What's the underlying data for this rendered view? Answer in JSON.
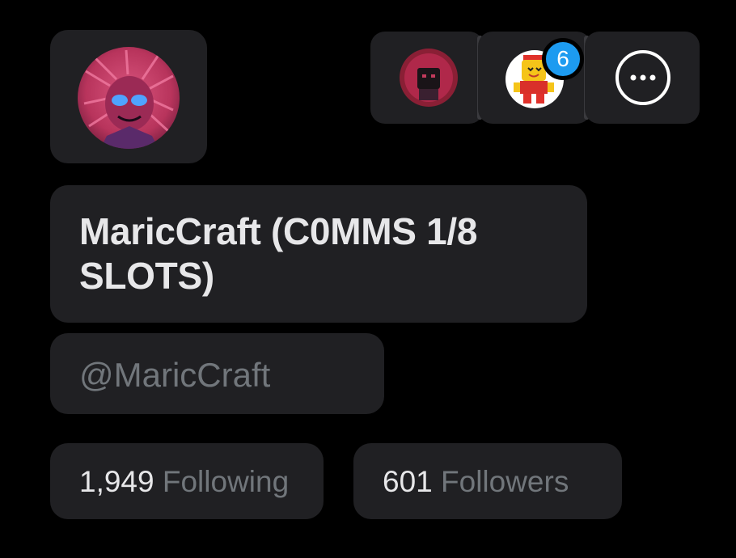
{
  "profile": {
    "display_name": "MaricCraft (C0MMS 1/8 SLOTS)",
    "handle": "@MaricCraft",
    "avatar_icon": "profile-avatar-icon"
  },
  "accounts": {
    "switch_account_1_icon": "account-avatar-icon",
    "switch_account_2_icon": "account-avatar-icon",
    "notification_badge": "6",
    "more_icon": "more-options-icon"
  },
  "stats": {
    "following_count": "1,949",
    "following_label": "Following",
    "followers_count": "601",
    "followers_label": "Followers"
  },
  "colors": {
    "background": "#000000",
    "card": "#202023",
    "primary_text": "#e7e7e9",
    "secondary_text": "#71767b",
    "badge": "#1d9bf0"
  }
}
